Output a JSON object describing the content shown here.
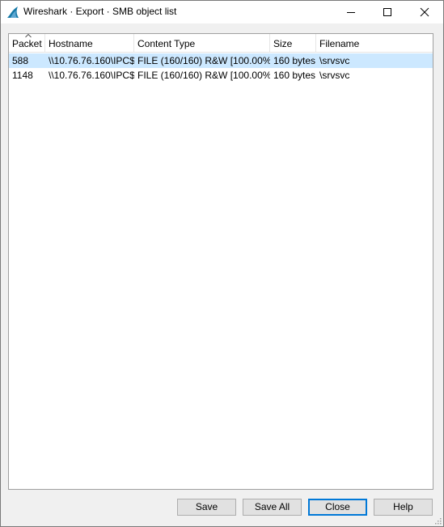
{
  "window": {
    "title": "Wireshark · Export · SMB object list",
    "icon": "wireshark-fin-icon"
  },
  "table": {
    "columns": [
      "Packet",
      "Hostname",
      "Content Type",
      "Size",
      "Filename"
    ],
    "sort_column": "Packet",
    "rows": [
      {
        "packet": "588",
        "hostname": "\\\\10.76.76.160\\IPC$",
        "content_type": "FILE (160/160) R&W [100.00%]",
        "size": "160 bytes",
        "filename": "\\srvsvc",
        "selected": true
      },
      {
        "packet": "1148",
        "hostname": "\\\\10.76.76.160\\IPC$",
        "content_type": "FILE (160/160) R&W [100.00%]",
        "size": "160 bytes",
        "filename": "\\srvsvc",
        "selected": false
      }
    ]
  },
  "buttons": {
    "save": "Save",
    "save_all": "Save All",
    "close": "Close",
    "help": "Help"
  },
  "colors": {
    "selection": "#cce8ff",
    "default_button_border": "#0078d7",
    "wireshark_blue": "#1679a7"
  }
}
